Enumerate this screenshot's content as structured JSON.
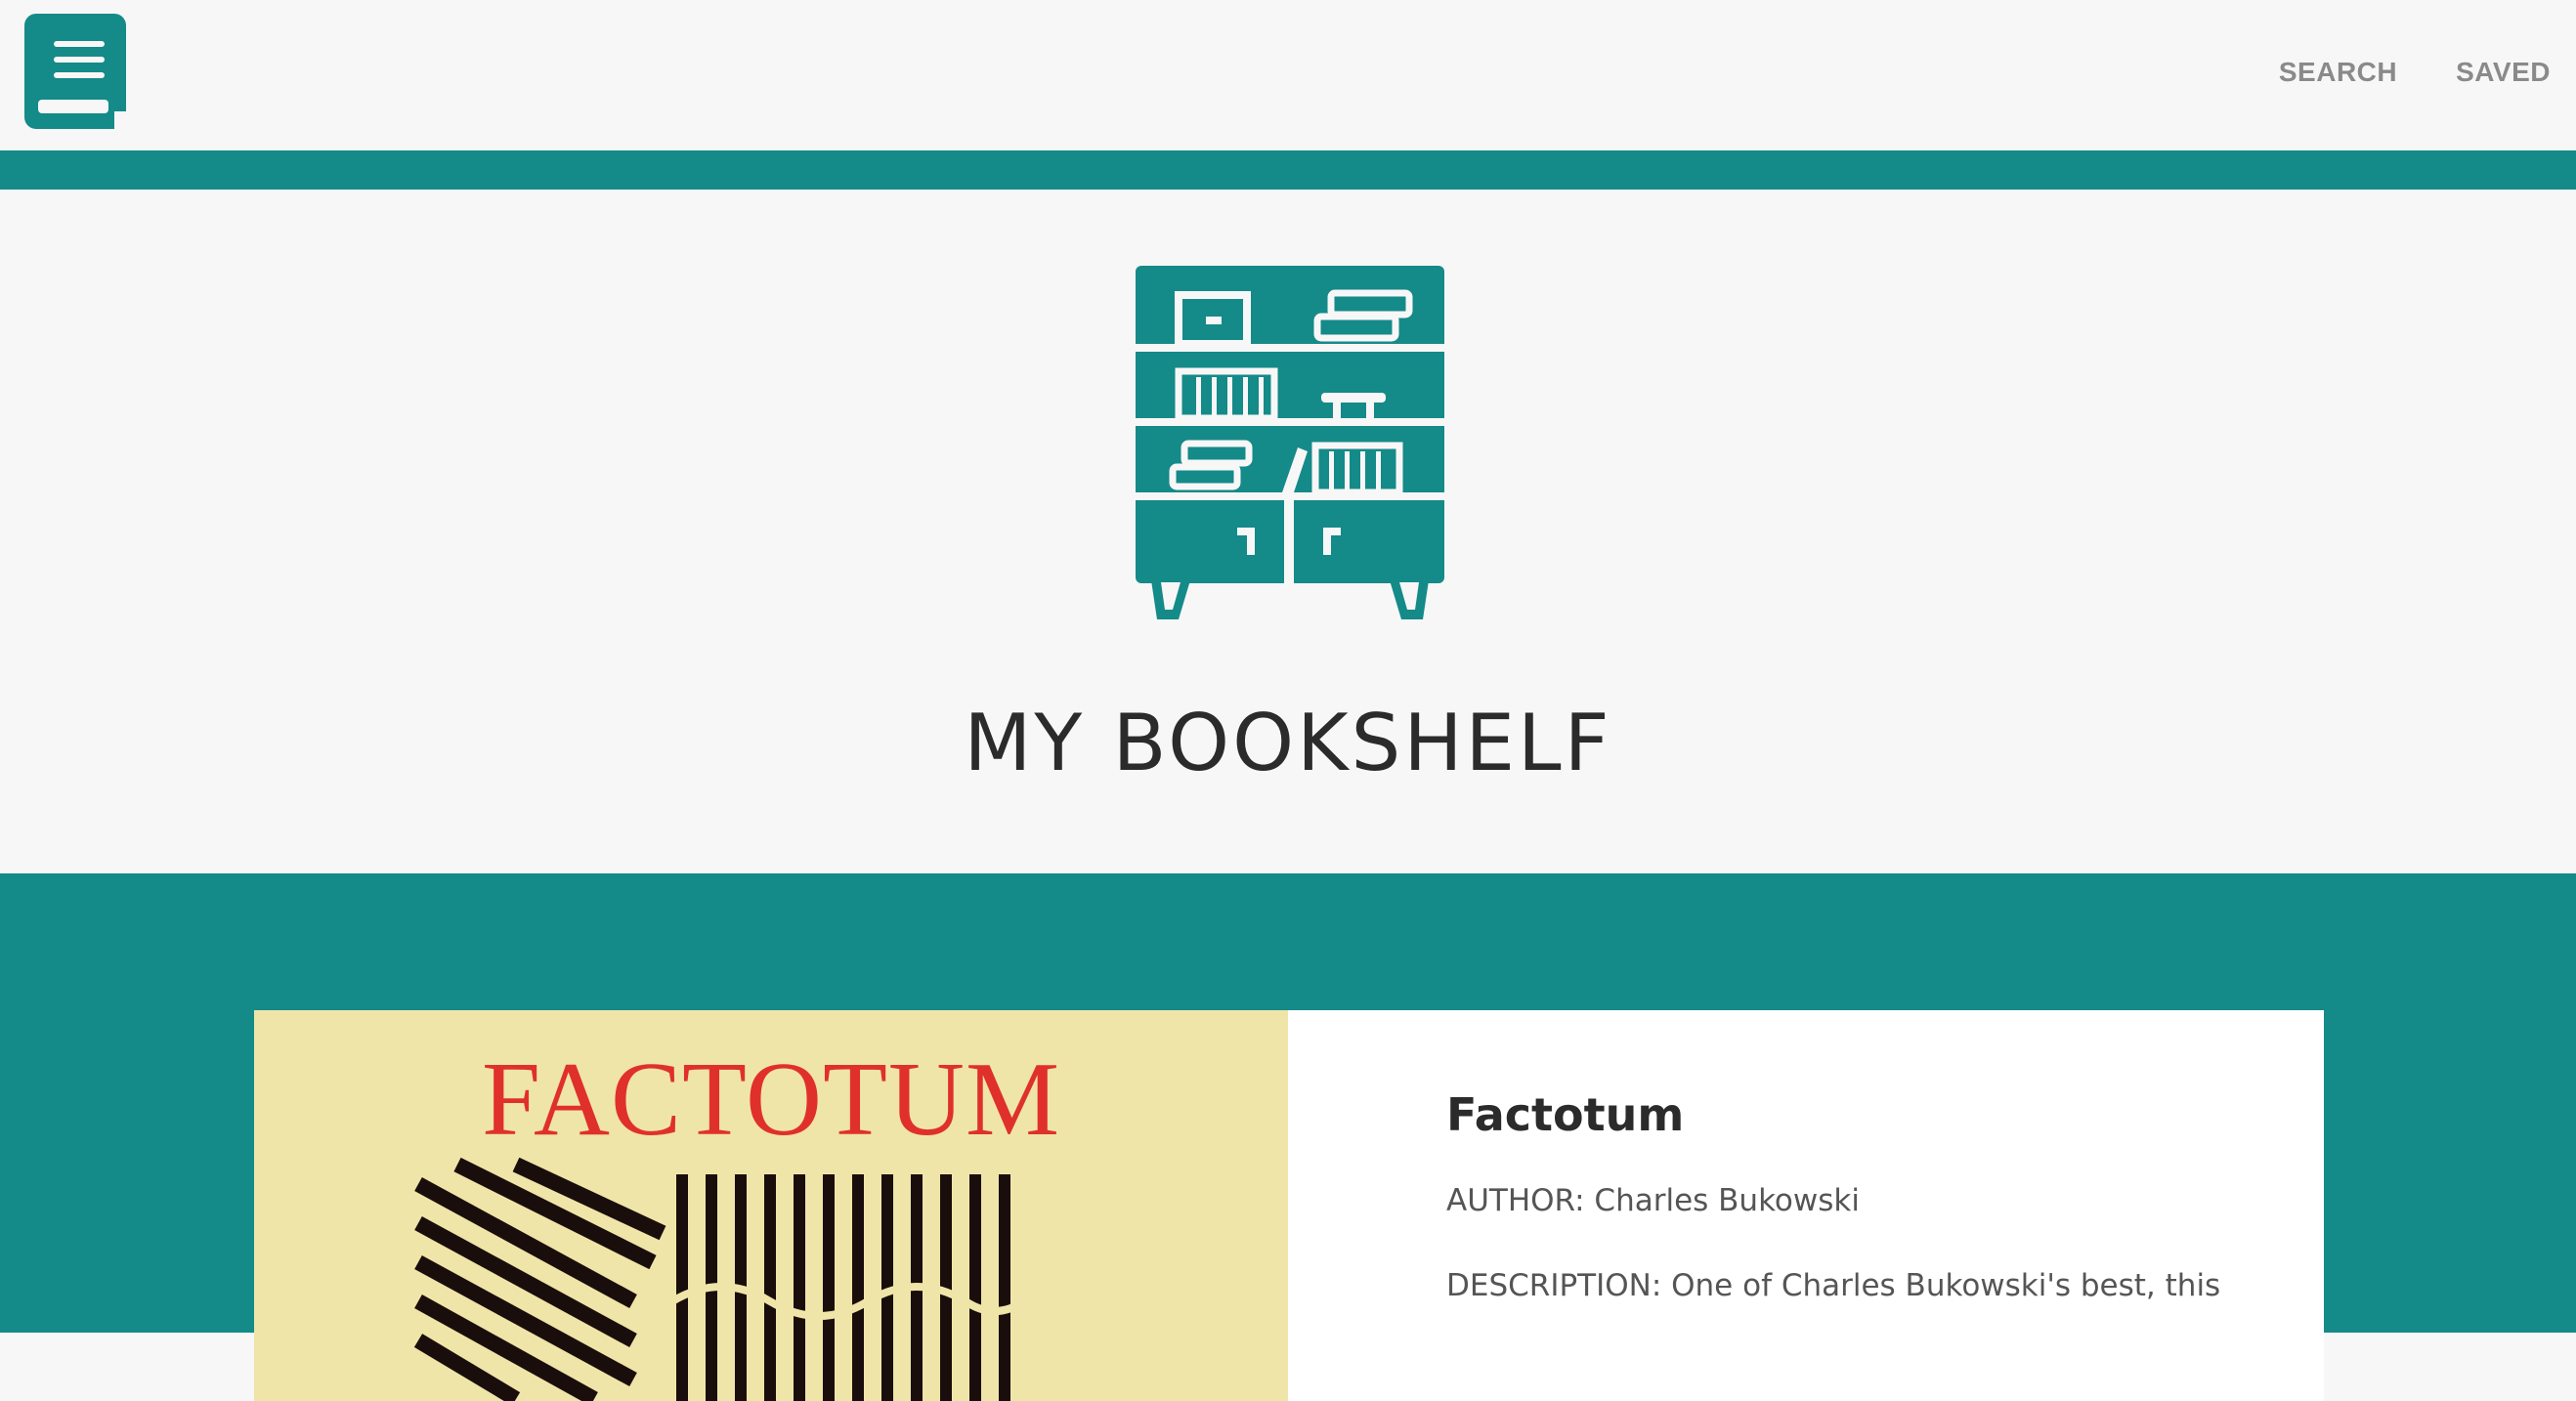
{
  "navbar": {
    "logo_icon": "book-menu-icon",
    "links": [
      "SEARCH",
      "SAVED"
    ]
  },
  "hero": {
    "icon": "bookshelf-icon",
    "title": "MY BOOKSHELF"
  },
  "colors": {
    "accent": "#148a89",
    "background": "#f7f7f7",
    "nav_link": "#8a8a8a",
    "heading": "#2b2b2b",
    "cover_bg": "#efe5a8",
    "cover_title": "#e0302b"
  },
  "books": [
    {
      "cover_text": "FACTOTUM",
      "title": "Factotum",
      "author_line": "AUTHOR: Charles Bukowski",
      "description_line": "DESCRIPTION: One of Charles Bukowski's best, this"
    }
  ]
}
